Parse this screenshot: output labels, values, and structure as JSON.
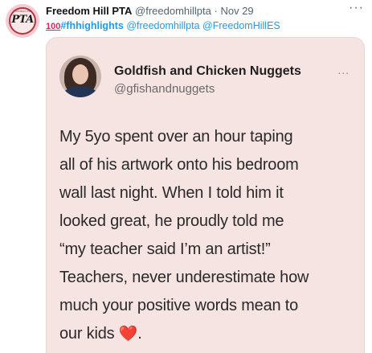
{
  "tweet": {
    "author": {
      "name": "Freedom Hill PTA",
      "handle": "@freedomhillpta",
      "dot": "·",
      "date": "Nov 29",
      "avatar_text": "PTA",
      "avatar_small_text": "Freedom Hill"
    },
    "more_icon": "more-horizontal-icon",
    "tags": {
      "hundred": "100",
      "hashtag": "#fhhighlights",
      "mentions": [
        "@freedomhillpta",
        "@FreedomHillES"
      ]
    },
    "colors": {
      "accent": "#1d9bf0",
      "card_bg": "#f6e4e2",
      "heart": "#d42a3a"
    }
  },
  "media": {
    "name": "Goldfish and Chicken Nuggets",
    "handle": "@gfishandnuggets",
    "more": "...",
    "lines": [
      "My 5yo spent over an hour taping",
      "all of his artwork onto his bedroom",
      "wall last night.  When I told him it",
      "looked great, he proudly told me",
      "“my teacher said I’m an artist!”",
      "Teachers, never underestimate how",
      "much your positive words mean to"
    ],
    "last_line_prefix": "our kids",
    "heart": "❤️",
    "last_line_suffix": "."
  }
}
